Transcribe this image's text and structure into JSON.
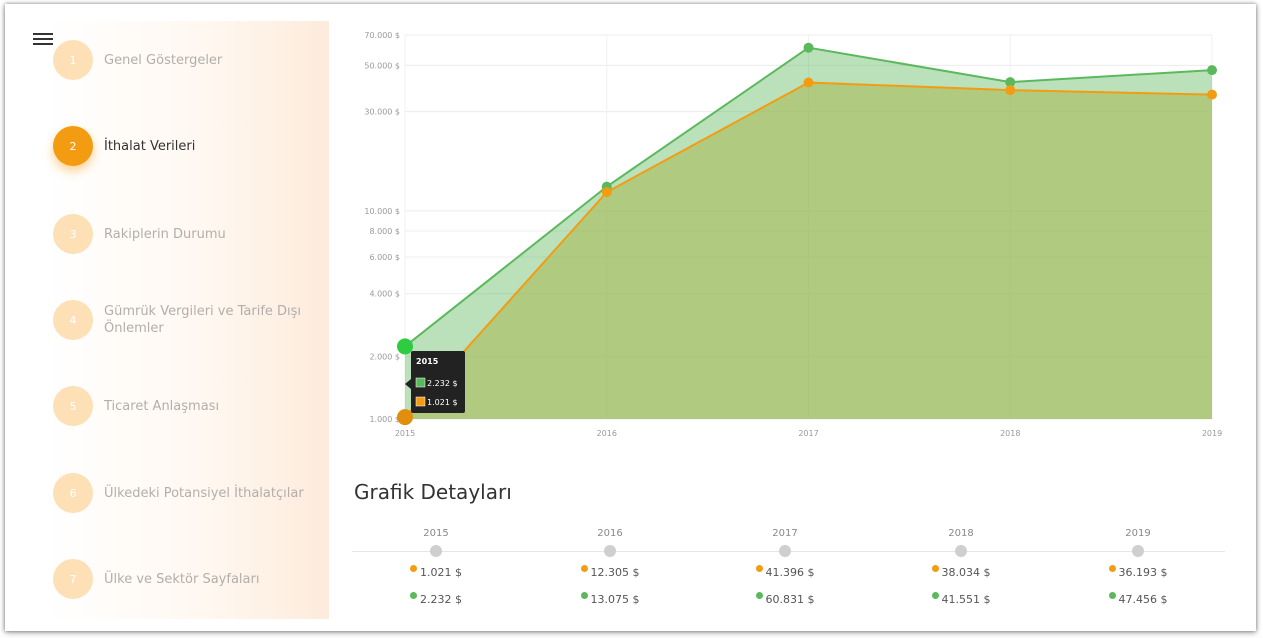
{
  "sidebar": {
    "steps": [
      {
        "num": "1",
        "label": "Genel Göstergeler"
      },
      {
        "num": "2",
        "label": "İthalat Verileri"
      },
      {
        "num": "3",
        "label": "Rakiplerin Durumu"
      },
      {
        "num": "4",
        "label": "Gümrük Vergileri ve Tarife Dışı Önlemler"
      },
      {
        "num": "5",
        "label": "Ticaret Anlaşması"
      },
      {
        "num": "6",
        "label": "Ülkedeki Potansiyel İthalatçılar"
      },
      {
        "num": "7",
        "label": "Ülke ve Sektör Sayfaları"
      }
    ],
    "active_index": 1
  },
  "chart_data": {
    "type": "area",
    "x": [
      "2015",
      "2016",
      "2017",
      "2018",
      "2019"
    ],
    "series": [
      {
        "color": "#5cb85c",
        "values": [
          2232,
          13075,
          60831,
          41551,
          47456
        ]
      },
      {
        "color": "#f39c12",
        "values": [
          1021,
          12305,
          41396,
          38034,
          36193
        ]
      }
    ],
    "y_ticks": [
      1000,
      2000,
      4000,
      6000,
      8000,
      10000,
      30000,
      50000,
      70000
    ],
    "y_tick_labels": [
      "1.000 $",
      "2.000 $",
      "4.000 $",
      "6.000 $",
      "8.000 $",
      "10.000 $",
      "30.000 $",
      "50.000 $",
      "70.000 $"
    ],
    "ylim": [
      1000,
      70000
    ],
    "scale": "log",
    "tooltip": {
      "title": "2015",
      "values": [
        "2.232 $",
        "1.021 $"
      ]
    }
  },
  "details": {
    "title": "Grafik Detayları",
    "columns": [
      {
        "year": "2015",
        "orange": "1.021 $",
        "green": "2.232 $"
      },
      {
        "year": "2016",
        "orange": "12.305 $",
        "green": "13.075 $"
      },
      {
        "year": "2017",
        "orange": "41.396 $",
        "green": "60.831 $"
      },
      {
        "year": "2018",
        "orange": "38.034 $",
        "green": "41.551 $"
      },
      {
        "year": "2019",
        "orange": "36.193 $",
        "green": "47.456 $"
      }
    ]
  },
  "colors": {
    "accent": "#f39c12",
    "green": "#5cb85c",
    "step_inactive": "#fde0b5"
  }
}
